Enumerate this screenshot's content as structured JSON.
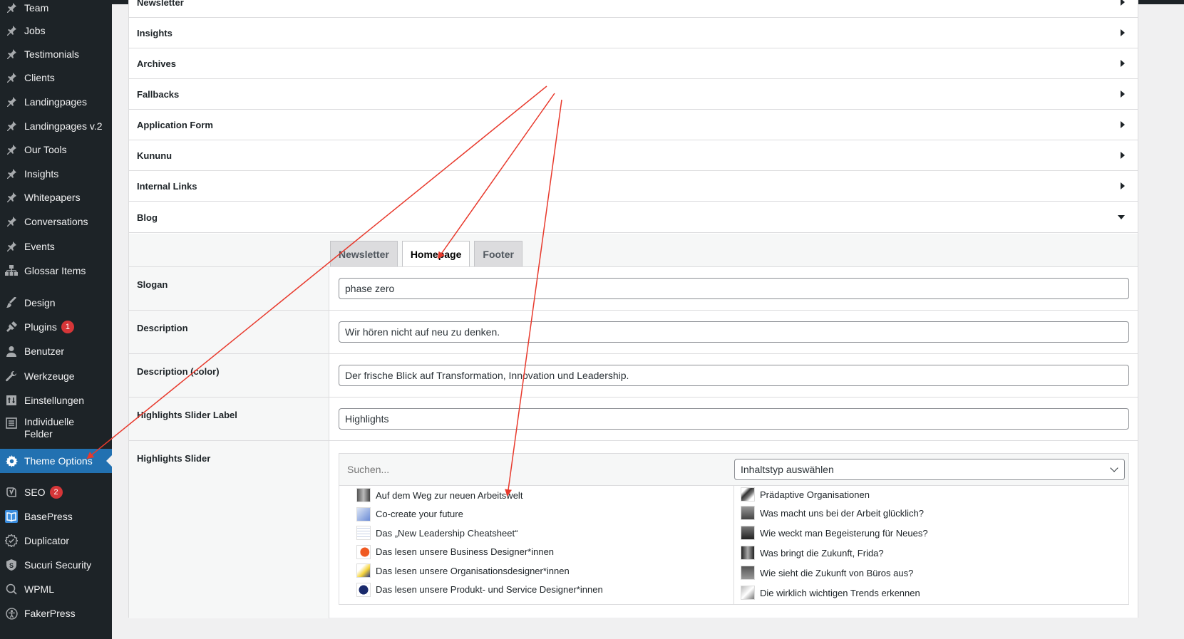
{
  "sidebar": {
    "items": [
      {
        "label": "Team",
        "icon": "pin-icon"
      },
      {
        "label": "Jobs",
        "icon": "pin-icon"
      },
      {
        "label": "Testimonials",
        "icon": "pin-icon"
      },
      {
        "label": "Clients",
        "icon": "pin-icon"
      },
      {
        "label": "Landingpages",
        "icon": "pin-icon"
      },
      {
        "label": "Landingpages v.2",
        "icon": "pin-icon"
      },
      {
        "label": "Our Tools",
        "icon": "pin-icon"
      },
      {
        "label": "Insights",
        "icon": "pin-icon"
      },
      {
        "label": "Whitepapers",
        "icon": "pin-icon"
      },
      {
        "label": "Conversations",
        "icon": "pin-icon"
      },
      {
        "label": "Events",
        "icon": "pin-icon"
      },
      {
        "label": "Glossar Items",
        "icon": "hierarchy-icon"
      },
      {
        "label": "Design",
        "icon": "brush-icon"
      },
      {
        "label": "Plugins",
        "icon": "plug-icon",
        "badge": "1"
      },
      {
        "label": "Benutzer",
        "icon": "user-icon"
      },
      {
        "label": "Werkzeuge",
        "icon": "wrench-icon"
      },
      {
        "label": "Einstellungen",
        "icon": "settings-icon"
      },
      {
        "label": "Individuelle Felder",
        "icon": "fields-icon"
      },
      {
        "label": "Theme Options",
        "icon": "gear-icon",
        "active": true
      },
      {
        "label": "SEO",
        "icon": "yoast-icon",
        "badge": "2"
      },
      {
        "label": "BasePress",
        "icon": "book-icon"
      },
      {
        "label": "Duplicator",
        "icon": "duplicator-icon"
      },
      {
        "label": "Sucuri Security",
        "icon": "shield-icon"
      },
      {
        "label": "WPML",
        "icon": "wpml-icon"
      },
      {
        "label": "FakerPress",
        "icon": "faker-icon"
      }
    ]
  },
  "accordion": {
    "sections": [
      "Newsletter",
      "Insights",
      "Archives",
      "Fallbacks",
      "Application Form",
      "Kununu",
      "Internal Links",
      "Blog"
    ]
  },
  "blog": {
    "tabs": [
      "Newsletter",
      "Homepage",
      "Footer"
    ],
    "active_tab": "Homepage",
    "fields": {
      "slogan": {
        "label": "Slogan",
        "value": "phase zero"
      },
      "description": {
        "label": "Description",
        "value": "Wir hören nicht auf neu zu denken."
      },
      "description_color": {
        "label": "Description (color)",
        "value": "Der frische Blick auf Transformation, Innovation und Leadership."
      },
      "highlights_label": {
        "label": "Highlights Slider Label",
        "value": "Highlights"
      },
      "highlights_slider": {
        "label": "Highlights Slider",
        "search_placeholder": "Suchen...",
        "type_select": "Inhaltstyp auswählen",
        "available": [
          "Auf dem Weg zur neuen Arbeitswelt",
          "Co-create your future",
          "Das „New Leadership Cheatsheet“",
          "Das lesen unsere Business Designer*innen",
          "Das lesen unsere Organisationsdesigner*innen",
          "Das lesen unsere Produkt- und Service Designer*innen"
        ],
        "selected": [
          "Prädaptive Organisationen",
          "Was macht uns bei der Arbeit glücklich?",
          "Wie weckt man Begeisterung für Neues?",
          "Was bringt die Zukunft, Frida?",
          "Wie sieht die Zukunft von Büros aus?",
          "Die wirklich wichtigen Trends erkennen"
        ]
      }
    }
  },
  "colors": {
    "sidebar_bg": "#1d2327",
    "active_menu": "#2271b1",
    "badge": "#d63638",
    "annotation_arrow": "#e8392c"
  }
}
